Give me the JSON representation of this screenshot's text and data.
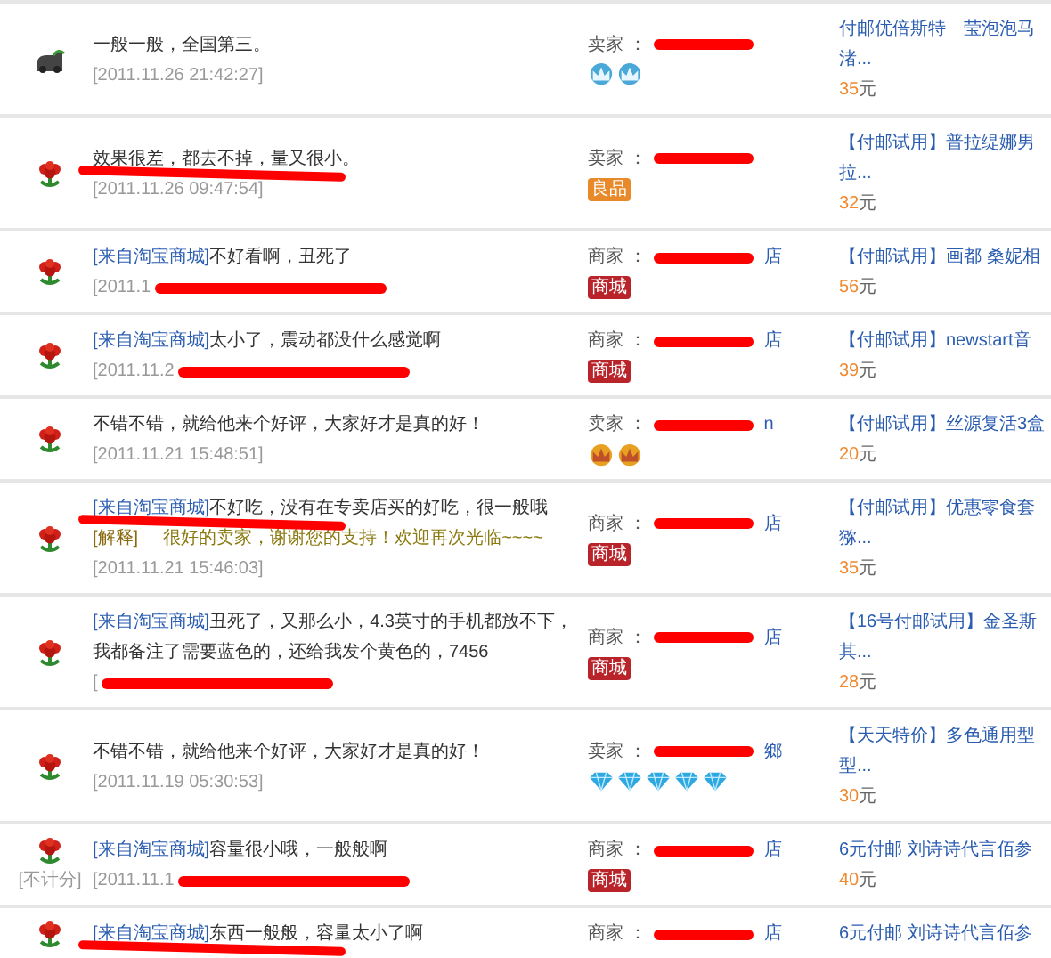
{
  "reviews": [
    {
      "avatar": {
        "kind": "car"
      },
      "comment": "一般一般，全国第三。",
      "comment_redacted": false,
      "date": "[2011.11.26 21:42:27]",
      "date_redacted": false,
      "seller": {
        "role": "卖家 ：",
        "name_redacted": true,
        "badges": [
          {
            "kind": "blue_crown"
          },
          {
            "kind": "blue_crown"
          }
        ]
      },
      "product": {
        "lines": [
          "付邮优倍斯特　莹泡泡马",
          "渚..."
        ],
        "price": "35",
        "unit": "元"
      }
    },
    {
      "avatar": {
        "kind": "flower"
      },
      "comment": "效果很差，都去不掉，量又很小。",
      "comment_redacted": true,
      "date": "[2011.11.26 09:47:54]",
      "date_redacted": false,
      "seller": {
        "role": "卖家 ：",
        "name_redacted": true,
        "badges": [
          {
            "kind": "label",
            "text": "良品",
            "color": "#e8892a"
          }
        ]
      },
      "product": {
        "lines": [
          "【付邮试用】普拉缇娜男",
          "拉..."
        ],
        "price": "32",
        "unit": "元"
      }
    },
    {
      "avatar": {
        "kind": "flower"
      },
      "source": "[来自淘宝商城]",
      "comment": "不好看啊，丑死了",
      "comment_redacted": false,
      "date": "[2011.1",
      "date_redacted": true,
      "seller": {
        "role": "商家 ：",
        "name": "店",
        "name_redacted": true,
        "badges": [
          {
            "kind": "label",
            "text": "商城",
            "color": "#b8242a"
          }
        ]
      },
      "product": {
        "lines": [
          "【付邮试用】画都 桑妮相"
        ],
        "price": "56",
        "unit": "元"
      }
    },
    {
      "avatar": {
        "kind": "flower"
      },
      "source": "[来自淘宝商城]",
      "comment": "太小了，震动都没什么感觉啊",
      "comment_redacted": false,
      "date": "[2011.11.2",
      "date_redacted": true,
      "seller": {
        "role": "商家 ：",
        "name": "店",
        "name_redacted": true,
        "badges": [
          {
            "kind": "label",
            "text": "商城",
            "color": "#b8242a"
          }
        ]
      },
      "product": {
        "lines": [
          "【付邮试用】newstart音"
        ],
        "price": "39",
        "unit": "元"
      }
    },
    {
      "avatar": {
        "kind": "flower"
      },
      "comment": "不错不错，就给他来个好评，大家好才是真的好！",
      "comment_redacted": false,
      "date": "[2011.11.21 15:48:51]",
      "date_redacted": false,
      "seller": {
        "role": "卖家 ：",
        "name": "n",
        "name_redacted": true,
        "badges": [
          {
            "kind": "gold_crown"
          },
          {
            "kind": "gold_crown"
          }
        ]
      },
      "product": {
        "lines": [
          "【付邮试用】丝源复活3盒"
        ],
        "price": "20",
        "unit": "元"
      }
    },
    {
      "avatar": {
        "kind": "flower"
      },
      "source": "[来自淘宝商城]",
      "comment": "不好吃，没有在专卖店买的好吃，很一般哦",
      "comment_redacted": true,
      "reply": {
        "label": "[解释]",
        "text": "很好的卖家，谢谢您的支持！欢迎再次光临~~~~"
      },
      "date": "[2011.11.21 15:46:03]",
      "date_redacted": false,
      "seller": {
        "role": "商家 ：",
        "name": "店",
        "name_redacted": true,
        "badges": [
          {
            "kind": "label",
            "text": "商城",
            "color": "#b8242a"
          }
        ]
      },
      "product": {
        "lines": [
          "【付邮试用】优惠零食套",
          "猕..."
        ],
        "price": "35",
        "unit": "元"
      }
    },
    {
      "avatar": {
        "kind": "flower"
      },
      "source": "[来自淘宝商城]",
      "comment": "丑死了，又那么小，4.3英寸的手机都放不下，我都备注了需要蓝色的，还给我发个黄色的，7456",
      "comment_redacted": false,
      "date": "[",
      "date_redacted": true,
      "seller": {
        "role": "商家 ：",
        "name": "店",
        "name_redacted": true,
        "badges": [
          {
            "kind": "label",
            "text": "商城",
            "color": "#b8242a"
          }
        ]
      },
      "product": {
        "lines": [
          "【16号付邮试用】金圣斯",
          "其..."
        ],
        "price": "28",
        "unit": "元"
      }
    },
    {
      "avatar": {
        "kind": "flower"
      },
      "comment": "不错不错，就给他来个好评，大家好才是真的好！",
      "comment_redacted": false,
      "date": "[2011.11.19 05:30:53]",
      "date_redacted": false,
      "seller": {
        "role": "卖家 ：",
        "name": "鄉",
        "name_redacted": true,
        "badges": [
          {
            "kind": "diamond"
          },
          {
            "kind": "diamond"
          },
          {
            "kind": "diamond"
          },
          {
            "kind": "diamond"
          },
          {
            "kind": "diamond"
          }
        ]
      },
      "product": {
        "lines": [
          "【天天特价】多色通用型",
          "型..."
        ],
        "price": "30",
        "unit": "元"
      }
    },
    {
      "avatar": {
        "kind": "flower"
      },
      "not_counted": "[不计分]",
      "source": "[来自淘宝商城]",
      "comment": "容量很小哦，一般般啊",
      "comment_redacted": false,
      "date": "[2011.11.1",
      "date_redacted": true,
      "seller": {
        "role": "商家 ：",
        "name": "店",
        "name_redacted": true,
        "badges": [
          {
            "kind": "label",
            "text": "商城",
            "color": "#b8242a"
          }
        ]
      },
      "product": {
        "lines": [
          "6元付邮 刘诗诗代言佰参"
        ],
        "price": "40",
        "unit": "元"
      }
    },
    {
      "avatar": {
        "kind": "flower"
      },
      "source": "[来自淘宝商城]",
      "comment": "东西一般般，容量太小了啊",
      "comment_redacted": true,
      "seller": {
        "role": "商家 ：",
        "name": "店",
        "name_redacted": true
      },
      "product": {
        "lines": [
          "6元付邮 刘诗诗代言佰参"
        ]
      }
    }
  ]
}
